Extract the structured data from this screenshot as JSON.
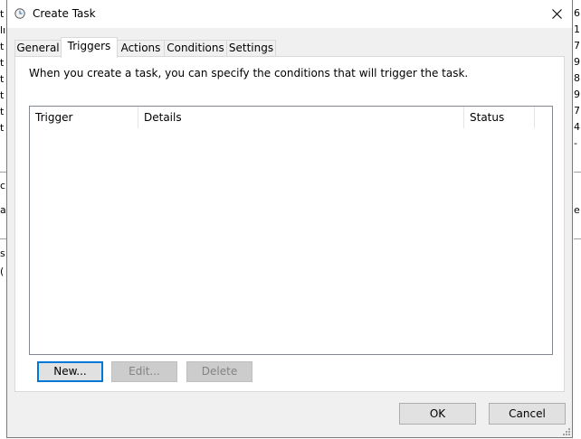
{
  "background_window": {
    "left_column_chars": [
      "t",
      "lı",
      "t",
      "t",
      "t",
      "t",
      "t",
      "t",
      "c",
      "a",
      "s",
      "("
    ],
    "right_column_chars": [
      "6",
      "1",
      "7:",
      "9",
      "8",
      "9",
      "7",
      "4",
      "-",
      "e"
    ]
  },
  "window": {
    "title": "Create Task",
    "close_glyph": "✕"
  },
  "tabs": [
    {
      "label": "General",
      "active": false
    },
    {
      "label": "Triggers",
      "active": true
    },
    {
      "label": "Actions",
      "active": false
    },
    {
      "label": "Conditions",
      "active": false
    },
    {
      "label": "Settings",
      "active": false
    }
  ],
  "triggers_panel": {
    "description": "When you create a task, you can specify the conditions that will trigger the task.",
    "columns": [
      "Trigger",
      "Details",
      "Status"
    ],
    "rows": [],
    "buttons": {
      "new": "New...",
      "edit": "Edit...",
      "delete": "Delete"
    }
  },
  "footer": {
    "ok": "OK",
    "cancel": "Cancel"
  },
  "icons": {
    "title_icon": "clock-icon",
    "close_icon": "close-icon",
    "grip_icon": "resize-grip-icon"
  },
  "colors": {
    "accent": "#0078d7",
    "dialog_bg": "#f0f0f0",
    "panel_bg": "#ffffff"
  }
}
